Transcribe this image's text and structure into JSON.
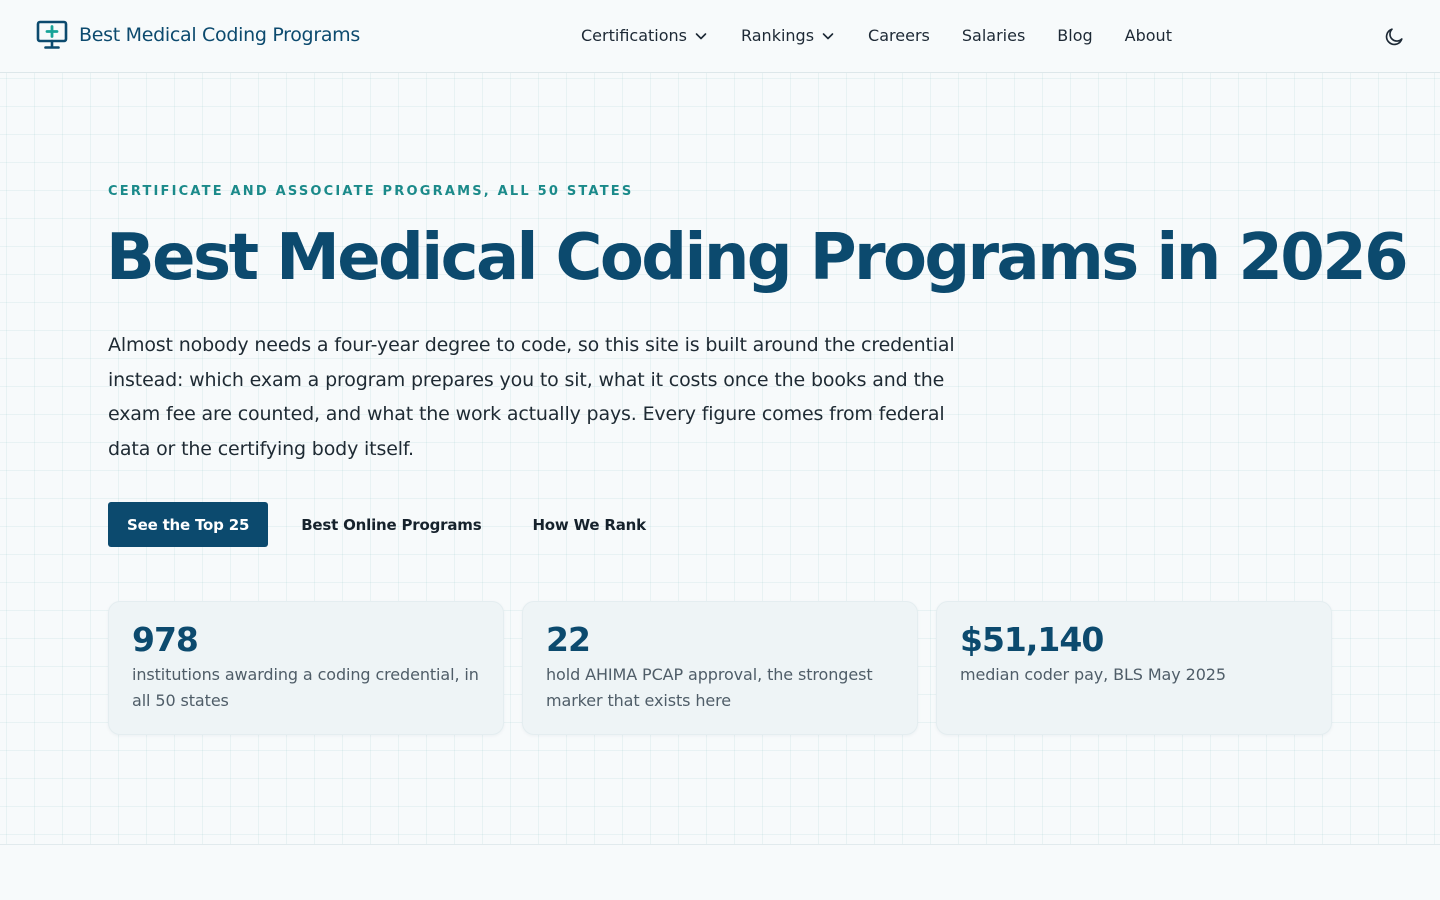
{
  "brand": {
    "name": "Best Medical Coding Programs",
    "icon": "monitor-plus-icon",
    "color": "#0c4a6e"
  },
  "nav": {
    "items": [
      {
        "label": "Certifications",
        "has_dropdown": true
      },
      {
        "label": "Rankings",
        "has_dropdown": true
      },
      {
        "label": "Careers",
        "has_dropdown": false
      },
      {
        "label": "Salaries",
        "has_dropdown": false
      },
      {
        "label": "Blog",
        "has_dropdown": false
      },
      {
        "label": "About",
        "has_dropdown": false
      }
    ],
    "theme_toggle_icon": "moon-icon"
  },
  "hero": {
    "eyebrow": "CERTIFICATE AND ASSOCIATE PROGRAMS, ALL 50 STATES",
    "title": "Best Medical Coding Programs in 2026",
    "intro": "Almost nobody needs a four-year degree to code, so this site is built around the credential instead: which exam a program prepares you to sit, what it costs once the books and the exam fee are counted, and what the work actually pays. Every figure comes from federal data or the certifying body itself.",
    "cta_primary": "See the Top 25",
    "cta_secondary": "Best Online Programs",
    "cta_tertiary": "How We Rank"
  },
  "stats": [
    {
      "value": "978",
      "label": "institutions awarding a coding credential, in all 50 states"
    },
    {
      "value": "22",
      "label": "hold AHIMA PCAP approval, the strongest marker that exists here"
    },
    {
      "value": "$51,140",
      "label": "median coder pay, BLS May 2025"
    }
  ],
  "colors": {
    "accent": "#0c4a6e",
    "eyebrow": "#1b8a8a",
    "background": "#f7fafb",
    "card": "#eef4f6"
  }
}
